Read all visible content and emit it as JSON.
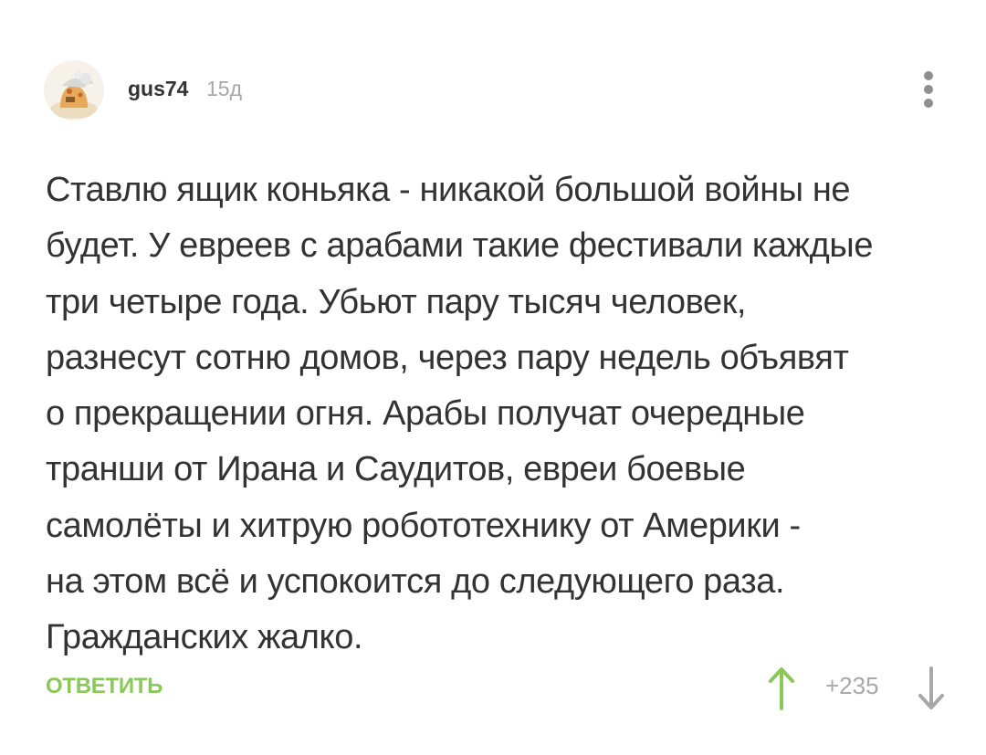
{
  "comment": {
    "author": "gus74",
    "time": "15д",
    "lines": [
      "Ставлю ящик коньяка - никакой большой войны не",
      "будет. У евреев с арабами такие фестивали каждые",
      "три четыре года. Убьют пару тысяч человек,",
      "разнесут сотню домов, через пару недель объявят",
      "о прекращении огня. Арабы получат очередные",
      "транши от Ирана и Саудитов, евреи боевые",
      "самолёты и хитрую робототехнику от Америки -",
      "на этом всё и успокоится до следующего раза.",
      "Гражданских жалко."
    ],
    "reply_label": "ОТВЕТИТЬ",
    "rating": "+235"
  },
  "colors": {
    "accent_green": "#8ac858",
    "vote_up": "#8ac858",
    "vote_down": "#a8a8a8",
    "text": "#333333",
    "muted": "#a8a8a8"
  },
  "icons": {
    "avatar": "avatar-image",
    "more": "more-vertical-icon",
    "vote_up": "arrow-up-icon",
    "vote_down": "arrow-down-icon"
  }
}
